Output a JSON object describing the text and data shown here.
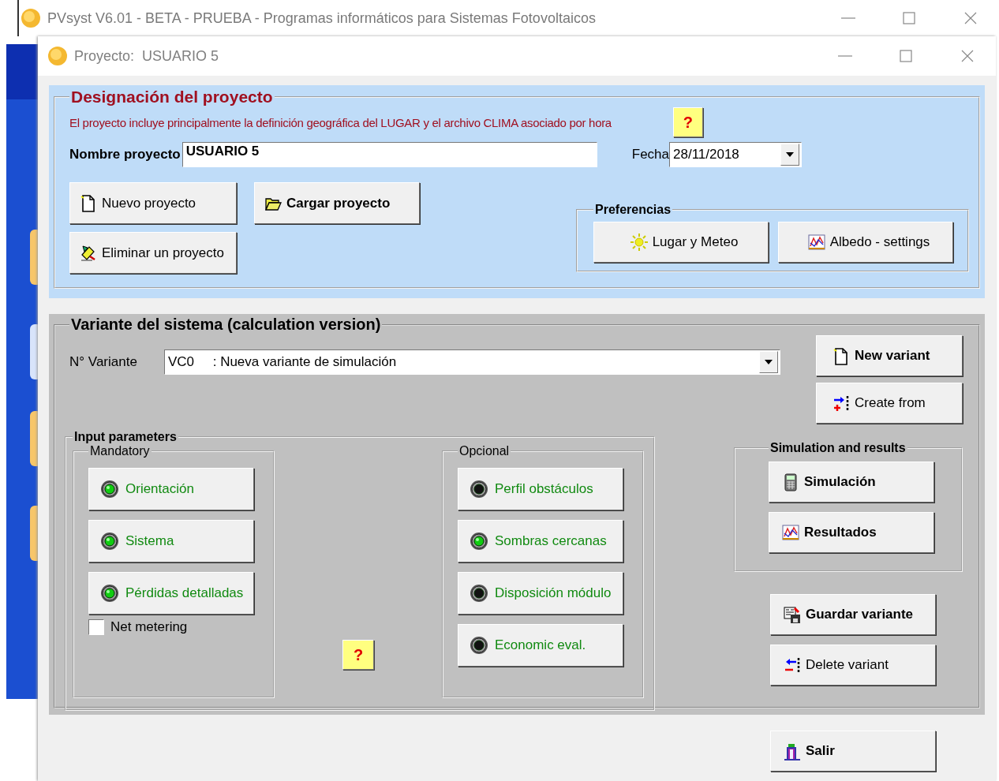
{
  "main_window": {
    "title": "PVsyst V6.01 - BETA - PRUEBA - Programas informáticos para Sistemas Fotovoltaicos"
  },
  "dialog": {
    "title": "Proyecto:  USUARIO 5"
  },
  "project": {
    "legend": "Designación del proyecto",
    "description": "El proyecto incluye principalmente la definición geográfica del LUGAR y el archivo CLIMA asociado por hora",
    "help": "?",
    "name_label": "Nombre proyecto",
    "name_value": "USUARIO 5",
    "date_label": "Fecha",
    "date_value": "28/11/2018",
    "buttons": [
      {
        "label": "Nuevo proyecto",
        "kind": "new",
        "bold": false
      },
      {
        "label": "Cargar proyecto",
        "kind": "open",
        "bold": true
      },
      {
        "label": "Eliminar un proyecto",
        "kind": "erase",
        "bold": false
      }
    ],
    "preferences": {
      "legend": "Preferencias",
      "buttons": [
        {
          "label": "Lugar y Meteo",
          "kind": "sun",
          "bold": false
        },
        {
          "label": "Albedo - settings",
          "kind": "chart",
          "bold": false
        }
      ]
    }
  },
  "variant": {
    "legend": "Variante del sistema (calculation version)",
    "number_label": "N° Variante",
    "number_value": "VC0     : Nueva variante de simulación",
    "side_buttons": [
      {
        "label": "New variant",
        "kind": "new",
        "bold": true
      },
      {
        "label": "Create from",
        "kind": "add",
        "bold": false
      }
    ],
    "input_parameters": {
      "legend": "Input parameters",
      "help": "?",
      "mandatory": {
        "legend": "Mandatory",
        "items": [
          {
            "label": "Orientación",
            "on": true
          },
          {
            "label": "Sistema",
            "on": true
          },
          {
            "label": "Pérdidas detalladas",
            "on": true
          }
        ],
        "net_metering": {
          "label": "Net metering",
          "checked": false
        }
      },
      "optional": {
        "legend": "Opcional",
        "items": [
          {
            "label": "Perfil obstáculos",
            "on": false
          },
          {
            "label": "Sombras cercanas",
            "on": true
          },
          {
            "label": "Disposición módulo",
            "on": false
          },
          {
            "label": "Economic eval.",
            "on": false
          }
        ]
      }
    },
    "simulation": {
      "legend": "Simulation and results",
      "buttons": [
        {
          "label": "Simulación",
          "kind": "calc",
          "bold": true
        },
        {
          "label": "Resultados",
          "kind": "chart",
          "bold": true
        }
      ]
    },
    "actions": [
      {
        "label": "Guardar variante",
        "kind": "save",
        "bold": true
      },
      {
        "label": "Delete variant",
        "kind": "remove",
        "bold": false
      }
    ]
  },
  "exit_button": {
    "label": "Salir",
    "kind": "exit",
    "bold": true
  }
}
